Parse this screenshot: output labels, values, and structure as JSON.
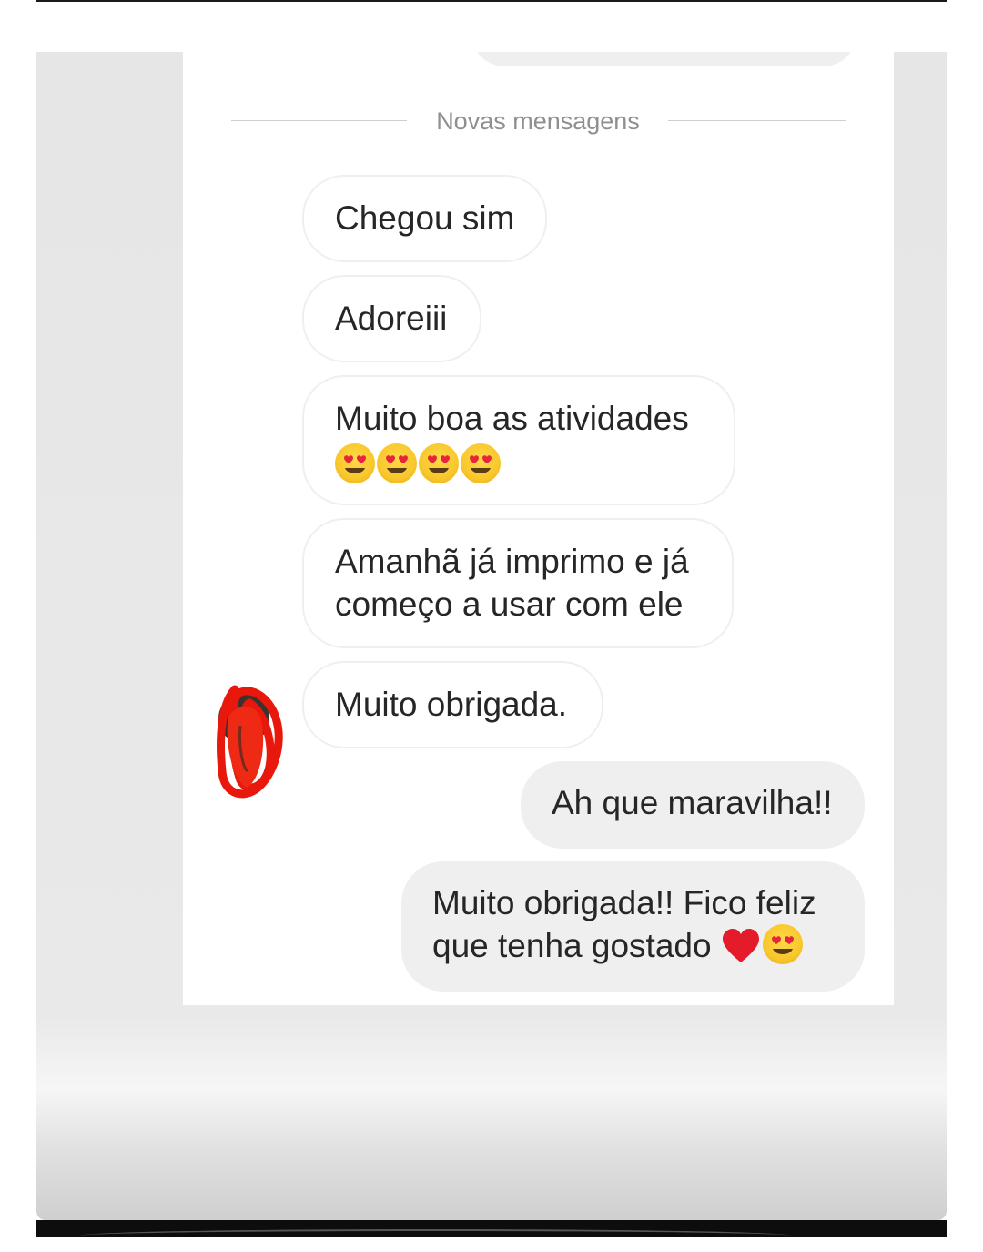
{
  "chat": {
    "divider_label": "Novas mensagens",
    "incoming": [
      {
        "text": "Chegou sim"
      },
      {
        "text": "Adoreiii"
      },
      {
        "line1": "Muito boa as atividades",
        "emoji": [
          "heart-eyes",
          "heart-eyes",
          "heart-eyes",
          "heart-eyes"
        ]
      },
      {
        "line1": "Amanhã já imprimo e já",
        "line2": "começo a usar com ele"
      },
      {
        "text": "Muito obrigada."
      }
    ],
    "outgoing": [
      {
        "text": "Ah que maravilha!!"
      },
      {
        "line1": "Muito obrigada!! Fico feliz",
        "line2": "que tenha gostado",
        "emoji": [
          "red-heart",
          "heart-eyes"
        ]
      }
    ]
  },
  "colors": {
    "incoming_bubble_border": "#efefef",
    "outgoing_bubble_bg": "#efefef",
    "text": "#262626",
    "divider_text": "#8f8f8f",
    "avatar_scribble": "#e8180c"
  }
}
